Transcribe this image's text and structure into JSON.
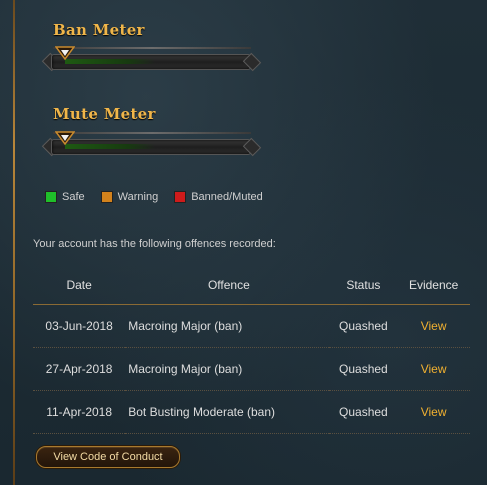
{
  "ban_meter": {
    "title": "Ban Meter",
    "level": 0
  },
  "mute_meter": {
    "title": "Mute Meter",
    "level": 0
  },
  "legend": [
    {
      "label": "Safe",
      "color": "#1fbf2a"
    },
    {
      "label": "Warning",
      "color": "#d2821c"
    },
    {
      "label": "Banned/Muted",
      "color": "#cf1b1b"
    }
  ],
  "intro_text": "Your account has the following offences recorded:",
  "table": {
    "headers": {
      "date": "Date",
      "offence": "Offence",
      "status": "Status",
      "evidence": "Evidence"
    },
    "rows": [
      {
        "date": "03-Jun-2018",
        "offence": "Macroing Major (ban)",
        "status": "Quashed",
        "evidence": "View"
      },
      {
        "date": "27-Apr-2018",
        "offence": "Macroing Major (ban)",
        "status": "Quashed",
        "evidence": "View"
      },
      {
        "date": "11-Apr-2018",
        "offence": "Bot Busting Moderate (ban)",
        "status": "Quashed",
        "evidence": "View"
      }
    ]
  },
  "code_of_conduct_button": "View Code of Conduct",
  "colors": {
    "accent": "#f0b64a",
    "link": "#f0b030",
    "background": "#1c2a33"
  }
}
